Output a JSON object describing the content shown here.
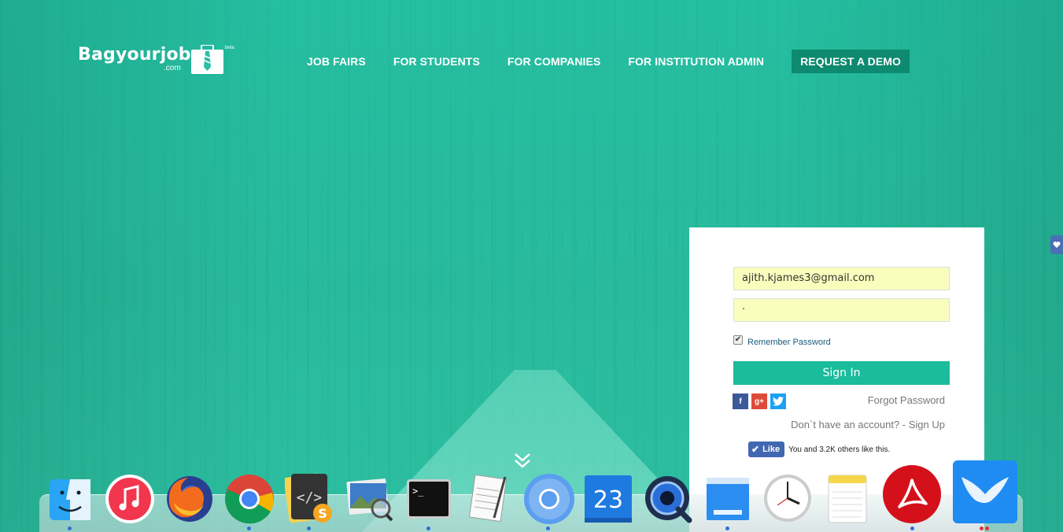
{
  "brand": {
    "name": "Bagyourjob",
    "sub": ".com",
    "tag": "beta"
  },
  "nav": {
    "items": [
      "JOB FAIRS",
      "FOR STUDENTS",
      "FOR COMPANIES",
      "FOR INSTITUTION ADMIN"
    ],
    "demo": "REQUEST A DEMO"
  },
  "login": {
    "email_value": "ajith.kjames3@gmail.com",
    "password_value": "·",
    "remember_label": "Remember Password",
    "remember_checked": true,
    "signin_label": "Sign In",
    "forgot_label": "Forgot Password",
    "signup_label": "Don`t have an account? - Sign Up",
    "social": {
      "facebook": "f",
      "google": "g+",
      "twitter": "t"
    },
    "like": {
      "label": "Like",
      "text": "You and 3.2K others like this."
    }
  },
  "dock": {
    "calendar_day": "23",
    "terminal_prompt": ">_",
    "items": [
      "finder-icon",
      "itunes-icon",
      "firefox-icon",
      "chrome-icon",
      "sublime-icon",
      "preview-icon",
      "terminal-icon",
      "textedit-icon",
      "chromium-icon",
      "calendar-icon",
      "quicktime-icon",
      "desktop-icon",
      "clock-icon",
      "notes-icon",
      "acrobat-icon",
      "mail-icon"
    ]
  },
  "colors": {
    "accent": "#1abc9c",
    "demo_bg": "#0d8a70",
    "input_bg": "#fafebd"
  }
}
